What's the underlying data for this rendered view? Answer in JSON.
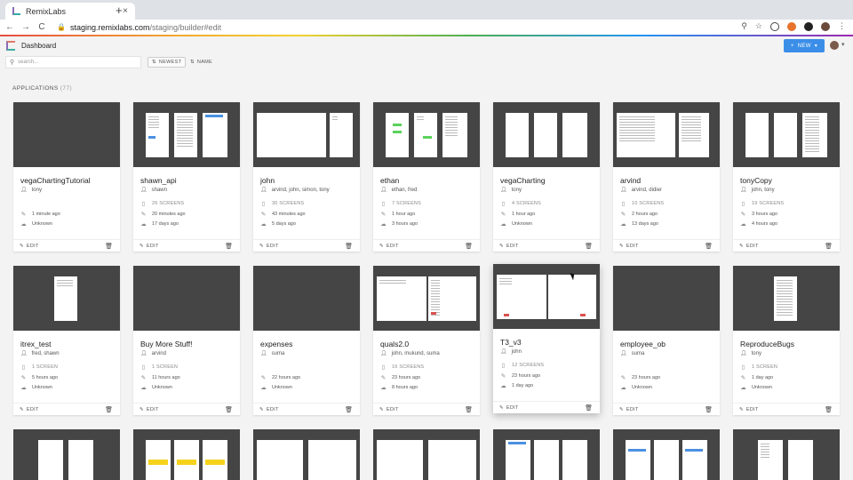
{
  "browser": {
    "tab_title": "RemixLabs",
    "tab_close": "×",
    "new_tab": "+",
    "back": "←",
    "forward": "→",
    "reload": "C",
    "url_host": "staging.remixlabs.com",
    "url_path": "/staging/builder#edit"
  },
  "app": {
    "title": "Dashboard",
    "new_button": "NEW",
    "new_plus": "+",
    "new_caret": "▾",
    "search_placeholder": "search...",
    "sort_newest": "NEWEST",
    "sort_name": "NAME",
    "section_title": "APPLICATIONS",
    "section_count": "(77)"
  },
  "card_actions": {
    "edit": "EDIT",
    "delete_icon": "trash-icon"
  },
  "cards": [
    {
      "name": "vegaChartingTutorial",
      "owners": "tony",
      "screens": "",
      "edited": "1 minute ago",
      "deployed": "Unknown"
    },
    {
      "name": "shawn_api",
      "owners": "shawn",
      "screens": "26 SCREENS",
      "edited": "20 minutes ago",
      "deployed": "17 days ago"
    },
    {
      "name": "john",
      "owners": "arvind, john, simon, tony",
      "screens": "30 SCREENS",
      "edited": "43 minutes ago",
      "deployed": "5 days ago"
    },
    {
      "name": "ethan",
      "owners": "ethan, fred",
      "screens": "7 SCREENS",
      "edited": "1 hour ago",
      "deployed": "3 hours ago"
    },
    {
      "name": "vegaCharting",
      "owners": "tony",
      "screens": "4 SCREENS",
      "edited": "1 hour ago",
      "deployed": "Unknown"
    },
    {
      "name": "arvind",
      "owners": "arvind, didier",
      "screens": "10 SCREENS",
      "edited": "2 hours ago",
      "deployed": "13 days ago"
    },
    {
      "name": "tonyCopy",
      "owners": "john, tony",
      "screens": "19 SCREENS",
      "edited": "3 hours ago",
      "deployed": "4 hours ago"
    },
    {
      "name": "itrex_test",
      "owners": "fred, shawn",
      "screens": "1 SCREEN",
      "edited": "5 hours ago",
      "deployed": "Unknown"
    },
    {
      "name": "Buy More Stuff!",
      "owners": "arvind",
      "screens": "1 SCREEN",
      "edited": "11 hours ago",
      "deployed": "Unknown"
    },
    {
      "name": "expenses",
      "owners": "suma",
      "screens": "",
      "edited": "22 hours ago",
      "deployed": "Unknown"
    },
    {
      "name": "quals2.0",
      "owners": "john, mukund, suma",
      "screens": "16 SCREENS",
      "edited": "23 hours ago",
      "deployed": "8 hours ago"
    },
    {
      "name": "T3_v3",
      "owners": "john",
      "screens": "12 SCREENS",
      "edited": "23 hours ago",
      "deployed": "1 day ago"
    },
    {
      "name": "employee_ob",
      "owners": "suma",
      "screens": "",
      "edited": "23 hours ago",
      "deployed": "Unknown"
    },
    {
      "name": "ReproduceBugs",
      "owners": "tony",
      "screens": "1 SCREEN",
      "edited": "1 day ago",
      "deployed": "Unknown"
    }
  ]
}
